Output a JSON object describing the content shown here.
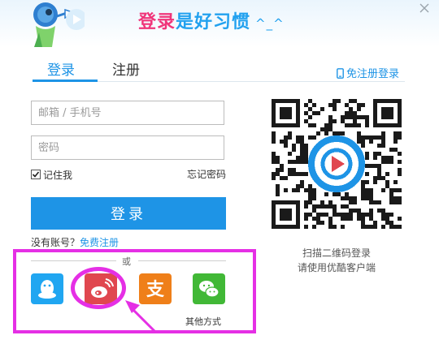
{
  "banner": {
    "slogan_part1": "登录",
    "slogan_part2": "是好习惯",
    "smiley": "^_^"
  },
  "tabs": [
    {
      "label": "登录",
      "active": true
    },
    {
      "label": "注册",
      "active": false
    }
  ],
  "sms_login_link": "免注册登录",
  "form": {
    "account_placeholder": "邮箱 / 手机号",
    "password_placeholder": "密码",
    "remember_label": "记住我",
    "remember_checked": true,
    "forgot_link": "忘记密码",
    "submit_label": "登录"
  },
  "register_prompt": {
    "text": "没有账号？",
    "link": "免费注册"
  },
  "divider_text": "或",
  "social_logins": [
    {
      "name": "qq",
      "icon": "qq-penguin-icon"
    },
    {
      "name": "weibo",
      "icon": "weibo-icon"
    },
    {
      "name": "alipay",
      "icon": "alipay-icon",
      "glyph": "支"
    },
    {
      "name": "wechat",
      "icon": "wechat-icon"
    }
  ],
  "other_methods_label": "其他方式",
  "qr": {
    "caption_line1": "扫描二维码登录",
    "caption_line2": "请使用优酷客户端"
  },
  "colors": {
    "accent": "#1e94e6",
    "slogan_pink": "#f0357a",
    "annotation_magenta": "#e52fe5",
    "qq": "#20a6f1",
    "weibo": "#e0474f",
    "alipay": "#ef7f19",
    "wechat": "#41b836"
  }
}
